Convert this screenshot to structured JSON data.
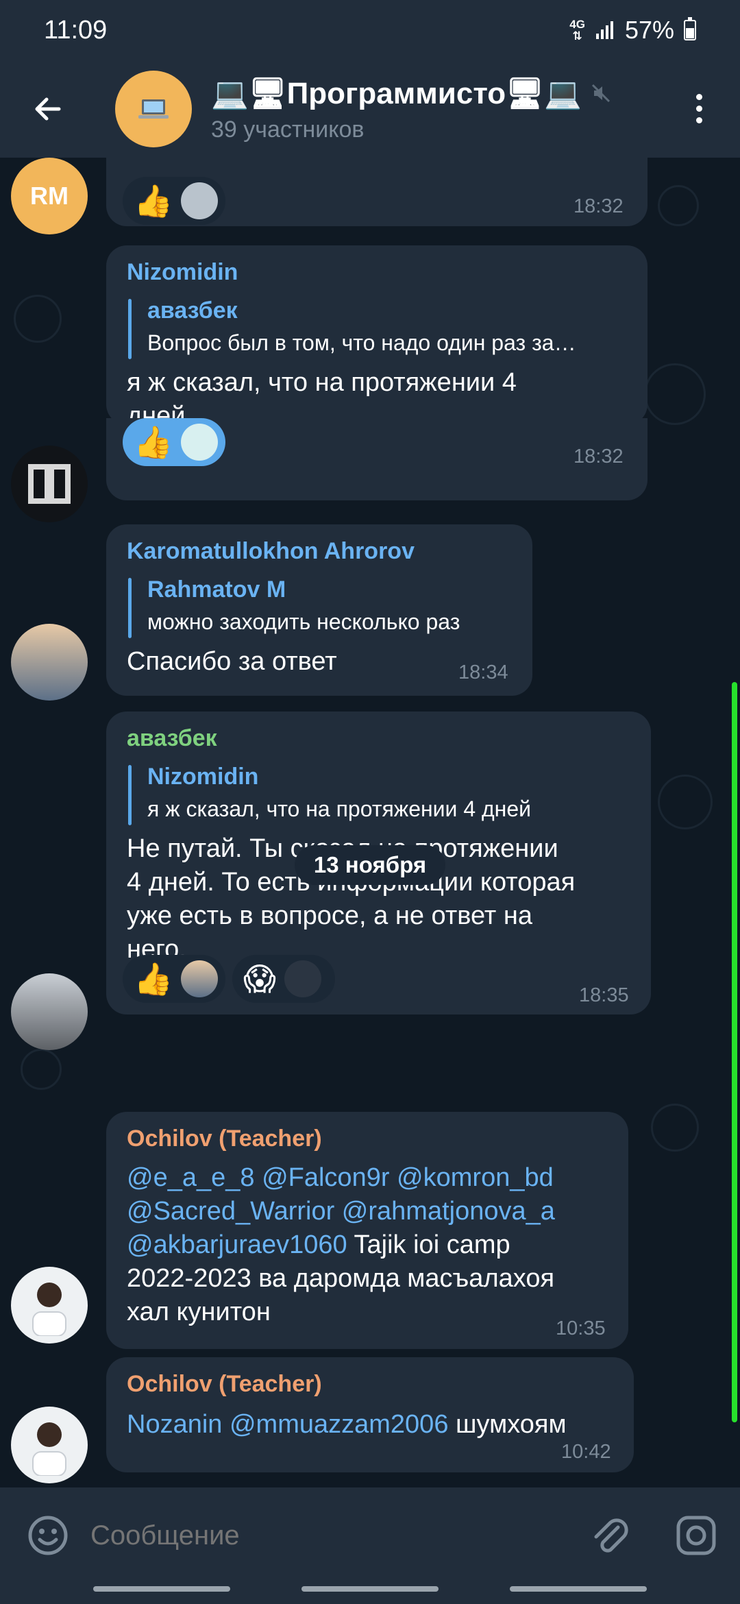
{
  "status_bar": {
    "time": "11:09",
    "network": "4G",
    "battery": "57%"
  },
  "header": {
    "title": "💻🖥Программисто🖥💻",
    "subtitle": "39 участников"
  },
  "messages": [
    {
      "time": "18:32",
      "avatar_initials": "RM",
      "reactions": [
        {
          "emoji": "👍"
        }
      ]
    },
    {
      "sender": "Nizomidin",
      "sender_color": "#6ab3f3",
      "reply_name": "авазбек",
      "reply_text": "Вопрос был в том, что надо один раз за…",
      "lines": [
        "я ж сказал, что на протяжении 4",
        "дней"
      ],
      "time": "18:32",
      "reactions": [
        {
          "emoji": "👍",
          "mine": true
        }
      ]
    },
    {
      "sender": "Karomatullokhon Ahrorov",
      "sender_color": "#6ab3f3",
      "reply_name": "Rahmatov M",
      "reply_text": "можно заходить несколько раз",
      "lines": [
        "Спасибо за ответ"
      ],
      "time": "18:34"
    },
    {
      "sender": "авазбек",
      "sender_color": "#7fd17f",
      "reply_name": "Nizomidin",
      "reply_text": "я ж сказал, что на протяжении 4 дней",
      "lines": [
        "Не путай. Ты сказал на протяжении",
        "4 дней. То есть информации которая",
        "уже есть в вопросе, а не ответ на",
        "него."
      ],
      "time": "18:35",
      "reactions": [
        {
          "emoji": "👍"
        },
        {
          "emoji": "😱"
        }
      ]
    },
    {
      "sender": "Ochilov (Teacher)",
      "sender_color": "#f0a070",
      "mentions_line1": "@e_a_e_8 @Falcon9r @komron_bd",
      "mentions_line2": "@Sacred_Warrior @rahmatjonova_a",
      "mentions_line3_mention": "@akbarjuraev1060",
      "line3_rest": " Tajik ioi camp",
      "line4": "2022-2023 ва даромда масъалахоя",
      "line5": "хал кунитон",
      "time": "10:35"
    },
    {
      "sender": "Ochilov (Teacher)",
      "sender_color": "#f0a070",
      "mention": "Nozanin @mmuazzam2006",
      "rest": " шумхоям",
      "time": "10:42"
    }
  ],
  "date_separator": "13 ноября",
  "input": {
    "placeholder": "Сообщение"
  },
  "icons": {
    "back": "back-arrow-icon",
    "mute": "muted-speaker-icon",
    "menu": "more-vert-icon",
    "emoji": "emoji-icon",
    "attach": "attach-icon",
    "camera": "camera-icon"
  }
}
